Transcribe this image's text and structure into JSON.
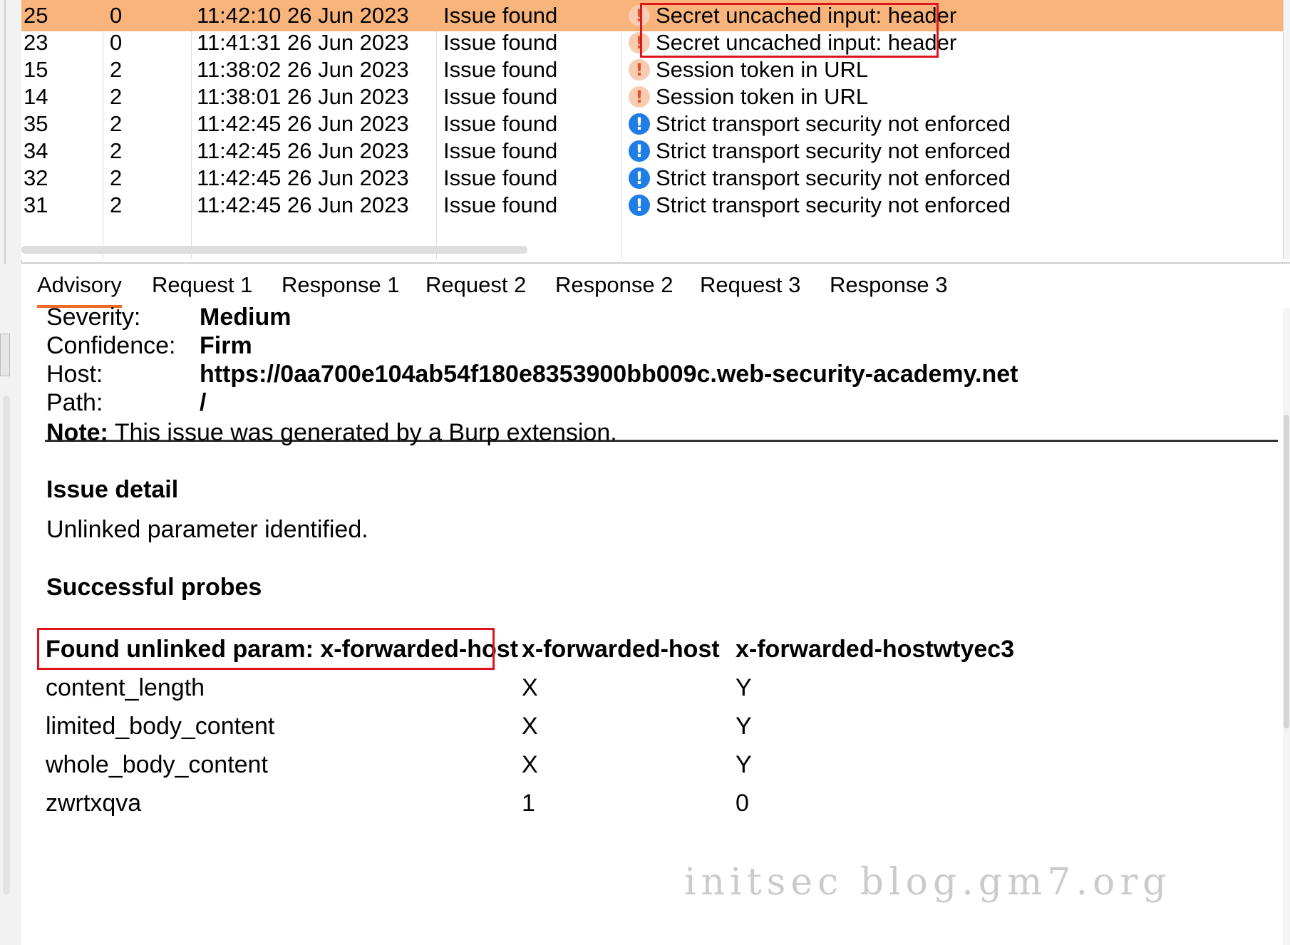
{
  "issue_table": {
    "rows": [
      {
        "id": "25",
        "severity": "0",
        "time": "11:42:10 26 Jun 2023",
        "type": "Issue found",
        "issue": "Secret uncached input: header",
        "icon": "medium-severity-icon",
        "selected": true
      },
      {
        "id": "23",
        "severity": "0",
        "time": "11:41:31 26 Jun 2023",
        "type": "Issue found",
        "issue": "Secret uncached input: header",
        "icon": "medium-severity-icon",
        "selected": false
      },
      {
        "id": "15",
        "severity": "2",
        "time": "11:38:02 26 Jun 2023",
        "type": "Issue found",
        "issue": "Session token in URL",
        "icon": "medium-severity-icon",
        "selected": false
      },
      {
        "id": "14",
        "severity": "2",
        "time": "11:38:01 26 Jun 2023",
        "type": "Issue found",
        "issue": "Session token in URL",
        "icon": "medium-severity-icon",
        "selected": false
      },
      {
        "id": "35",
        "severity": "2",
        "time": "11:42:45 26 Jun 2023",
        "type": "Issue found",
        "issue": "Strict transport security not enforced",
        "icon": "info-icon",
        "selected": false
      },
      {
        "id": "34",
        "severity": "2",
        "time": "11:42:45 26 Jun 2023",
        "type": "Issue found",
        "issue": "Strict transport security not enforced",
        "icon": "info-icon",
        "selected": false
      },
      {
        "id": "32",
        "severity": "2",
        "time": "11:42:45 26 Jun 2023",
        "type": "Issue found",
        "issue": "Strict transport security not enforced",
        "icon": "info-icon",
        "selected": false
      },
      {
        "id": "31",
        "severity": "2",
        "time": "11:42:45 26 Jun 2023",
        "type": "Issue found",
        "issue": "Strict transport security not enforced",
        "icon": "info-icon",
        "selected": false
      }
    ]
  },
  "tabs": [
    "Advisory",
    "Request 1",
    "Response 1",
    "Request 2",
    "Response 2",
    "Request 3",
    "Response 3"
  ],
  "active_tab": "Advisory",
  "advisory": {
    "meta": [
      {
        "label": "Severity:",
        "value": "Medium"
      },
      {
        "label": "Confidence:",
        "value": "Firm"
      },
      {
        "label": "Host:",
        "value": "https://0aa700e104ab54f180e8353900bb009c.web-security-academy.net"
      },
      {
        "label": "Path:",
        "value": "/"
      }
    ],
    "note_label": "Note:",
    "note_text": " This issue was generated by a Burp extension.",
    "issue_detail_heading": "Issue detail",
    "issue_detail_text": "Unlinked parameter identified.",
    "probes_heading": "Successful probes",
    "probes_table": {
      "headers": [
        "Found unlinked param: x-forwarded-host",
        "x-forwarded-host",
        "x-forwarded-hostwtyec3"
      ],
      "rows": [
        [
          "content_length",
          "X",
          "Y"
        ],
        [
          "limited_body_content",
          "X",
          "Y"
        ],
        [
          "whole_body_content",
          "X",
          "Y"
        ],
        [
          "zwrtxqva",
          "1",
          "0"
        ]
      ]
    }
  },
  "watermark": "initsec blog.gm7.org",
  "colors": {
    "selected_row": "#f8b47a",
    "highlight_border": "#e0141c",
    "active_tab_underline": "#f06a27",
    "medium_icon": "#f9cbb0",
    "info_icon": "#1e7ee6"
  }
}
